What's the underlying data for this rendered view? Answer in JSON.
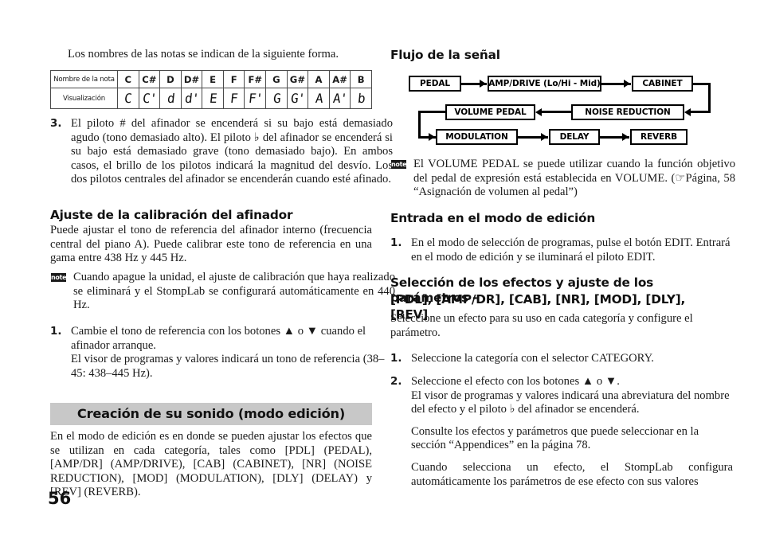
{
  "page": {
    "number": "56"
  },
  "left": {
    "intro": "Los nombres de las notas se indican de la siguiente forma.",
    "note_table": {
      "row_labels": [
        "Nombre de la nota",
        "Visualización"
      ],
      "note_names": [
        "C",
        "C#",
        "D",
        "D#",
        "E",
        "F",
        "F#",
        "G",
        "G#",
        "A",
        "A#",
        "B"
      ],
      "displays": [
        "C",
        "C'",
        "d",
        "d'",
        "E",
        "F",
        "F'",
        "G",
        "G'",
        "A",
        "A'",
        "b"
      ]
    },
    "item3": {
      "number": "3.",
      "text": "El piloto # del afinador se encenderá si su bajo está demasiado agudo (tono demasiado alto). El piloto ♭ del afinador se encenderá si su bajo está demasiado grave (tono demasiado bajo). En ambos casos, el brillo de los pilotos indicará la magnitud del desvío. Los dos pilotos centrales del afinador se encenderán cuando esté afinado."
    },
    "heading_calibracion": "Ajuste de la calibración del afinador",
    "calibracion_text": "Puede ajustar el tono de referencia del afinador interno (frecuencia central del piano A). Puede calibrar este tono de referencia en una gama entre 438 Hz y 445 Hz.",
    "note1": {
      "icon_label": "note",
      "text": "Cuando apague la unidad, el ajuste de calibración que haya realizado se eliminará y el StompLab se configurará automáticamente en 440 Hz."
    },
    "item1": {
      "number": "1.",
      "text": "Cambie el tono de referencia con  los botones ▲ o ▼ cuando el afinador arranque.",
      "sub1": "El visor de programas y valores indicará un tono de referencia (38–45: 438–445 Hz)."
    },
    "banner": "Creación de su sonido (modo edición)",
    "banner_text": "En el modo de edición es en donde se pueden ajustar los efectos que se utilizan en cada categoría, tales como [PDL] (PEDAL), [AMP/DR] (AMP/DRIVE), [CAB] (CABINET), [NR] (NOISE REDUCTION), [MOD] (MODULATION), [DLY] (DELAY) y [REV] (REVERB)."
  },
  "right": {
    "heading_flujo": "Flujo de la señal",
    "diagram": {
      "boxes": [
        {
          "id": "pedal",
          "label": "PEDAL"
        },
        {
          "id": "amp-drive",
          "label": "AMP/DRIVE (Lo/Hi - Mid)"
        },
        {
          "id": "cabinet",
          "label": "CABINET"
        },
        {
          "id": "volume-pedal",
          "label": "VOLUME PEDAL"
        },
        {
          "id": "noise-reduction",
          "label": "NOISE REDUCTION"
        },
        {
          "id": "modulation",
          "label": "MODULATION"
        },
        {
          "id": "delay",
          "label": "DELAY"
        },
        {
          "id": "reverb",
          "label": "REVERB"
        }
      ]
    },
    "note1": {
      "icon_label": "note",
      "text": "El VOLUME PEDAL se puede utilizar cuando la función objetivo del pedal de expresión está establecida en VOLUME. (☞Página, 58 “Asignación de volumen al pedal”)"
    },
    "heading_entrada": "Entrada en el modo de edición",
    "item1": {
      "number": "1.",
      "text": "En el modo de selección de programas, pulse el botón EDIT. Entrará en el modo de edición y se iluminará el piloto EDIT."
    },
    "heading_seleccion_line1": "Selección de los efectos y ajuste de los parámetros -",
    "heading_seleccion_line2": "[PDL], [AMP/DR], [CAB], [NR], [MOD], [DLY], [REV]",
    "seleccion_text": "Seleccione un efecto para su uso en cada categoría y configure el parámetro.",
    "item_cat": {
      "number": "1.",
      "text": "Seleccione la categoría con el selector CATEGORY."
    },
    "item_efecto": {
      "number": "2.",
      "text": "Seleccione el efecto con los botones ▲ o ▼.",
      "sub1": "El visor de programas y valores indicará una abreviatura del nombre del efecto y el piloto ♭ del afinador se encenderá.",
      "sub2": "Consulte los efectos y parámetros que puede seleccionar en la sección “Appendices” en la página 78.",
      "sub3": "Cuando selecciona un efecto, el StompLab configura automáticamente los parámetros de ese efecto con sus valores"
    }
  }
}
